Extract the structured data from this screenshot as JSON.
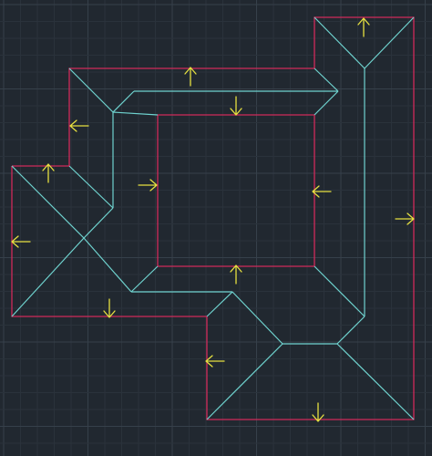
{
  "colors": {
    "background": "#212830",
    "grid_minor": "#2a323b",
    "grid_major": "#36404a",
    "boundary_line": "#d02a5a",
    "ridge_line": "#6fd3cf",
    "arrow": "#e6e040"
  },
  "drawing": {
    "boundary_label": "eave-outline",
    "ridge_label": "hip-and-ridge-lines",
    "arrow_label": "slope-direction-arrows"
  }
}
